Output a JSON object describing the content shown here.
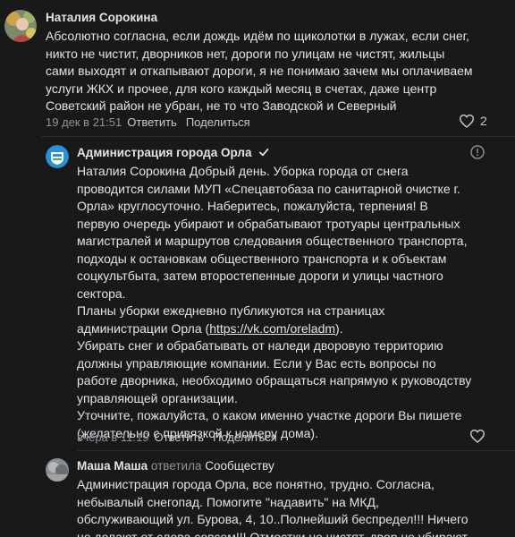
{
  "comments": [
    {
      "author": "Наталия Сорокина",
      "lines": [
        "Абсолютно согласна, если дождь идём по щиколотки в лужах, если снег,",
        "никто не чистит, дворников нет, дороги по улицам не чистят, жильцы",
        "сами выходят и откапывают дороги, я не понимаю зачем мы оплачиваем",
        "услуги ЖКХ и прочее, для кого каждый месяц в счетах, даже центр",
        "Советский район не убран, не то что Заводской и Северный"
      ],
      "time": "19 дек в 21:51",
      "reply_label": "Ответить",
      "share_label": "Поделиться",
      "likes": "2",
      "avatar_icon": "user-photo"
    },
    {
      "author": "Администрация города Орла",
      "verified_icon": "verified-checkmark-icon",
      "lines": [
        "Наталия Сорокина Добрый день. Уборка города от снега",
        "проводится силами МУП «Спецавтобаза по санитарной очистке г.",
        "Орла» круглосуточно. Наберитесь, пожалуйста, терпения! В",
        "первую очередь убирают и обрабатывают тротуары центральных",
        "магистралей и маршрутов следования общественного транспорта,",
        "подходы к остановкам общественного транспорта и к объектам",
        "соцкультбыта, затем второстепенные дороги и улицы частного",
        "сектора.",
        "Планы уборки ежедневно публикуются на страницах",
        "администрации Орла (",
        "Убирать снег и обрабатывать от наледи дворовую территорию",
        "должны управляющие компании. Если у Вас есть вопросы по",
        "работе дворника, необходимо обращаться напрямую к руководству",
        "управляющей организации.",
        "Уточните, пожалуйста, о каком именно участке дороги Вы пишете",
        "(желательно с привязкой к номеру дома)."
      ],
      "link": "https://vk.com/oreladm",
      "link_suffix": ").",
      "time": "вчера в 11:19",
      "reply_label": "Ответить",
      "share_label": "Поделиться",
      "avatar_icon": "city-coat-of-arms",
      "info_icon": "info-icon",
      "like_icon": "heart-icon"
    },
    {
      "author": "Маша Маша",
      "replied_label": "ответила",
      "replied_to": "Сообществу",
      "lines": [
        "Администрация города Орла, все понятно, трудно. Согласна,",
        "небывалый снегопад. Помогите \"надавить\" на МКД,",
        "обслуживающий ул. Бурова, 4, 10..Полнейший беспредел!!! Ничего",
        "не делают от слова совсем!!! Отмостки не чистят, двор не убирают,"
      ],
      "avatar_icon": "user-photo"
    }
  ],
  "colors": {
    "background": "#19191a",
    "text": "#e1e3e6",
    "secondary": "#8f9399",
    "divider": "#2c2d2e",
    "verified": "#e1e3e6"
  }
}
